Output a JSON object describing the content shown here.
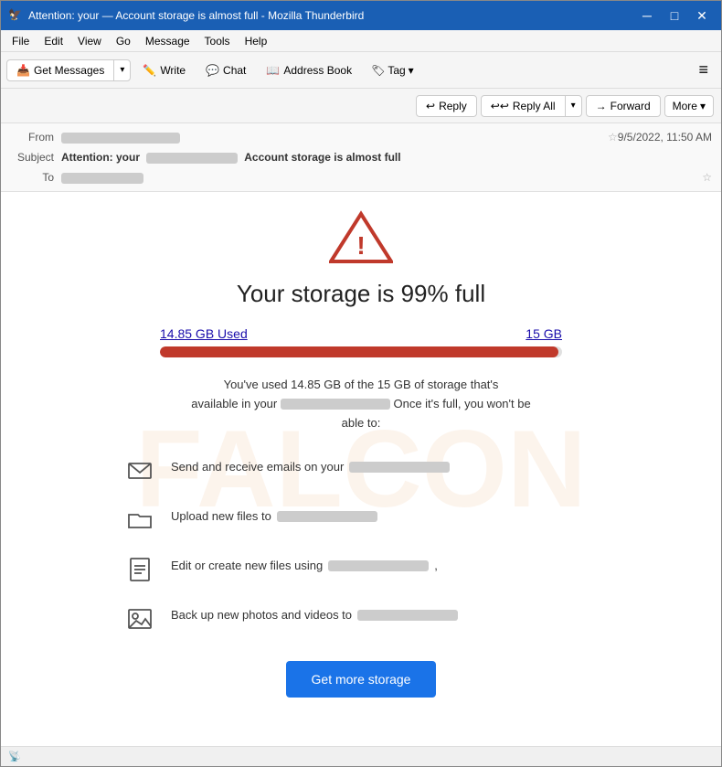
{
  "window": {
    "title": "Attention: your — Account storage is almost full - Mozilla Thunderbird",
    "app_icon": "🦅"
  },
  "window_controls": {
    "minimize": "─",
    "maximize": "□",
    "close": "✕"
  },
  "menu_bar": {
    "items": [
      "File",
      "Edit",
      "View",
      "Go",
      "Message",
      "Tools",
      "Help"
    ]
  },
  "toolbar": {
    "get_messages_label": "Get Messages",
    "write_label": "Write",
    "chat_label": "Chat",
    "address_book_label": "Address Book",
    "tag_label": "Tag"
  },
  "action_bar": {
    "reply_label": "Reply",
    "reply_all_label": "Reply All",
    "forward_label": "Forward",
    "more_label": "More"
  },
  "header": {
    "from_label": "From",
    "from_value": "██████████████",
    "subject_label": "Subject",
    "subject_prefix": "Attention: your",
    "subject_blurred": "██████████████",
    "subject_suffix": "Account storage is almost full",
    "to_label": "To",
    "to_value": "██████████",
    "date": "9/5/2022, 11:50 AM"
  },
  "email": {
    "storage_title": "Your storage is 99% full",
    "used_label": "14.85 GB Used",
    "total_label": "15 GB",
    "progress_percent": 99,
    "body_line1": "You've used 14.85 GB of the  15 GB of storage that's",
    "body_blurred": "████████████████",
    "body_line2": "available in your",
    "body_line3": "Once it's full, you won't be",
    "body_line4": "able to:",
    "features": [
      {
        "icon": "envelope",
        "text": "Send and receive emails on your",
        "blurred": "████████████████"
      },
      {
        "icon": "folder",
        "text": "Upload new files to",
        "blurred": "████████████████"
      },
      {
        "icon": "document",
        "text": "Edit or create new files using",
        "blurred": "████████████████",
        "suffix": ","
      },
      {
        "icon": "image",
        "text": "Back up new photos and videos to",
        "blurred": "████████████████"
      }
    ],
    "cta_label": "Get more storage"
  },
  "status_bar": {
    "icon": "📡"
  }
}
